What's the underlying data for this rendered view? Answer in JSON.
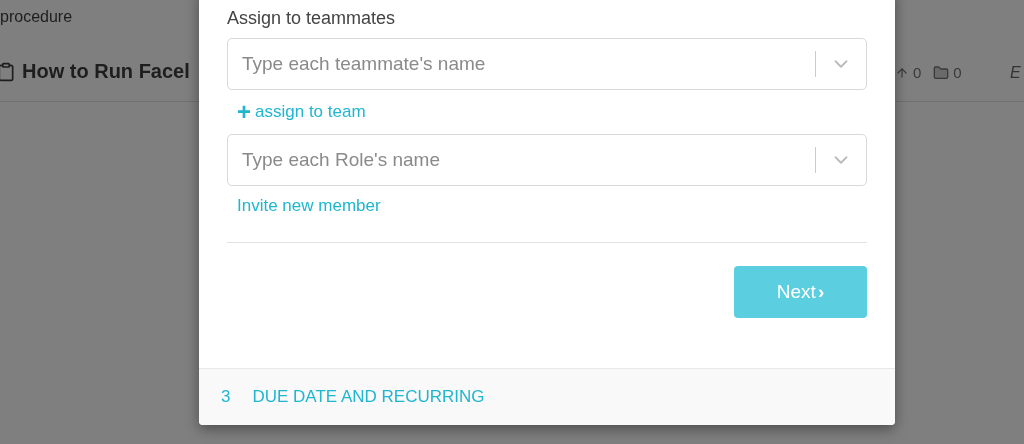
{
  "background_page": {
    "breadcrumb": "procedure",
    "title": "How to Run Facel",
    "counts": [
      {
        "kind": "arrow",
        "value": "0"
      },
      {
        "kind": "folder",
        "value": "0"
      }
    ],
    "edge_text": "E"
  },
  "modal": {
    "section_label": "Assign to teammates",
    "teammate_select": {
      "placeholder": "Type each teammate's name"
    },
    "assign_link": {
      "icon": "+",
      "label": "assign to team"
    },
    "role_select": {
      "placeholder": "Type each Role's name"
    },
    "invite_link": "Invite new member",
    "next_button": {
      "label": "Next",
      "icon": "›"
    },
    "footer_step": {
      "number": "3",
      "label": "DUE DATE AND RECURRING"
    }
  }
}
